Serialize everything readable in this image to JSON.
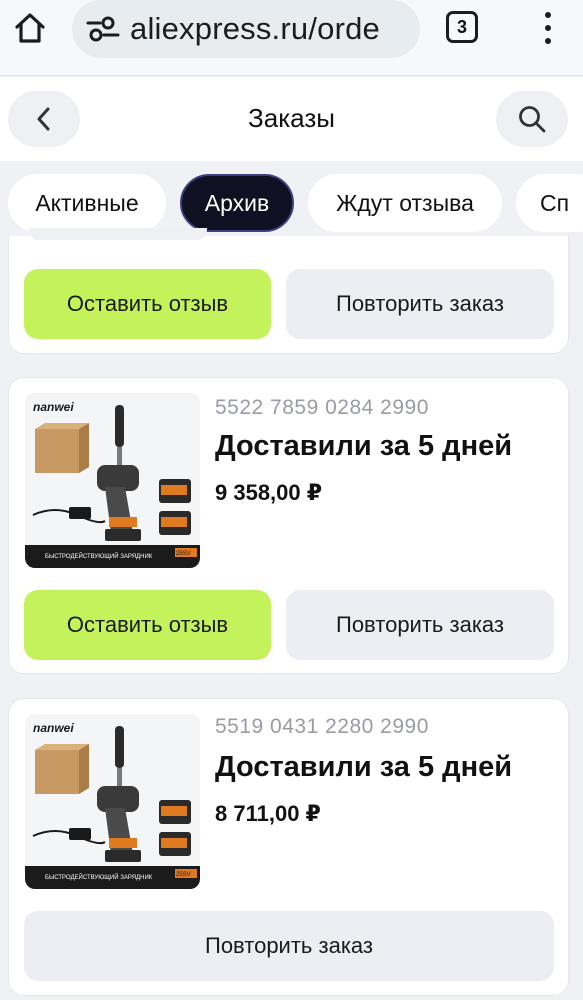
{
  "browser": {
    "url": "aliexpress.ru/orde",
    "tab_count": "3",
    "icons": [
      "home-icon",
      "site-settings-icon",
      "tabs-icon",
      "more-vert-icon"
    ]
  },
  "header": {
    "title": "Заказы",
    "icons": [
      "chevron-left-icon",
      "search-icon"
    ]
  },
  "filters": [
    {
      "label": "Активные",
      "active": false
    },
    {
      "label": "Архив",
      "active": true
    },
    {
      "label": "Ждут отзыва",
      "active": false
    },
    {
      "label": "Сп",
      "active": false
    }
  ],
  "first_card": {
    "review_label": "Оставить отзыв",
    "repeat_label": "Повторить заказ"
  },
  "orders": [
    {
      "order_number": "5522 7859 0284 2990",
      "status": "Доставили за 5 дней",
      "price": "9 358,00 ₽",
      "brand": "nanwei",
      "image_caption": "БЫСТРОДЕЙСТВУЮЩИЙ ЗАРЯДНИК",
      "image_badge": "25SV",
      "review_label": "Оставить отзыв",
      "repeat_label": "Повторить заказ"
    },
    {
      "order_number": "5519 0431 2280 2990",
      "status": "Доставили за 5 дней",
      "price": "8 711,00 ₽",
      "brand": "nanwei",
      "image_caption": "БЫСТРОДЕЙСТВУЮЩИЙ ЗАРЯДНИК",
      "image_badge": "25SV",
      "repeat_label": "Повторить заказ"
    }
  ],
  "colors": {
    "accent_green": "#c3f25a",
    "active_chip": "#0f1021",
    "page_bg": "#f0f1f5",
    "muted_text": "#9a9ca3"
  }
}
